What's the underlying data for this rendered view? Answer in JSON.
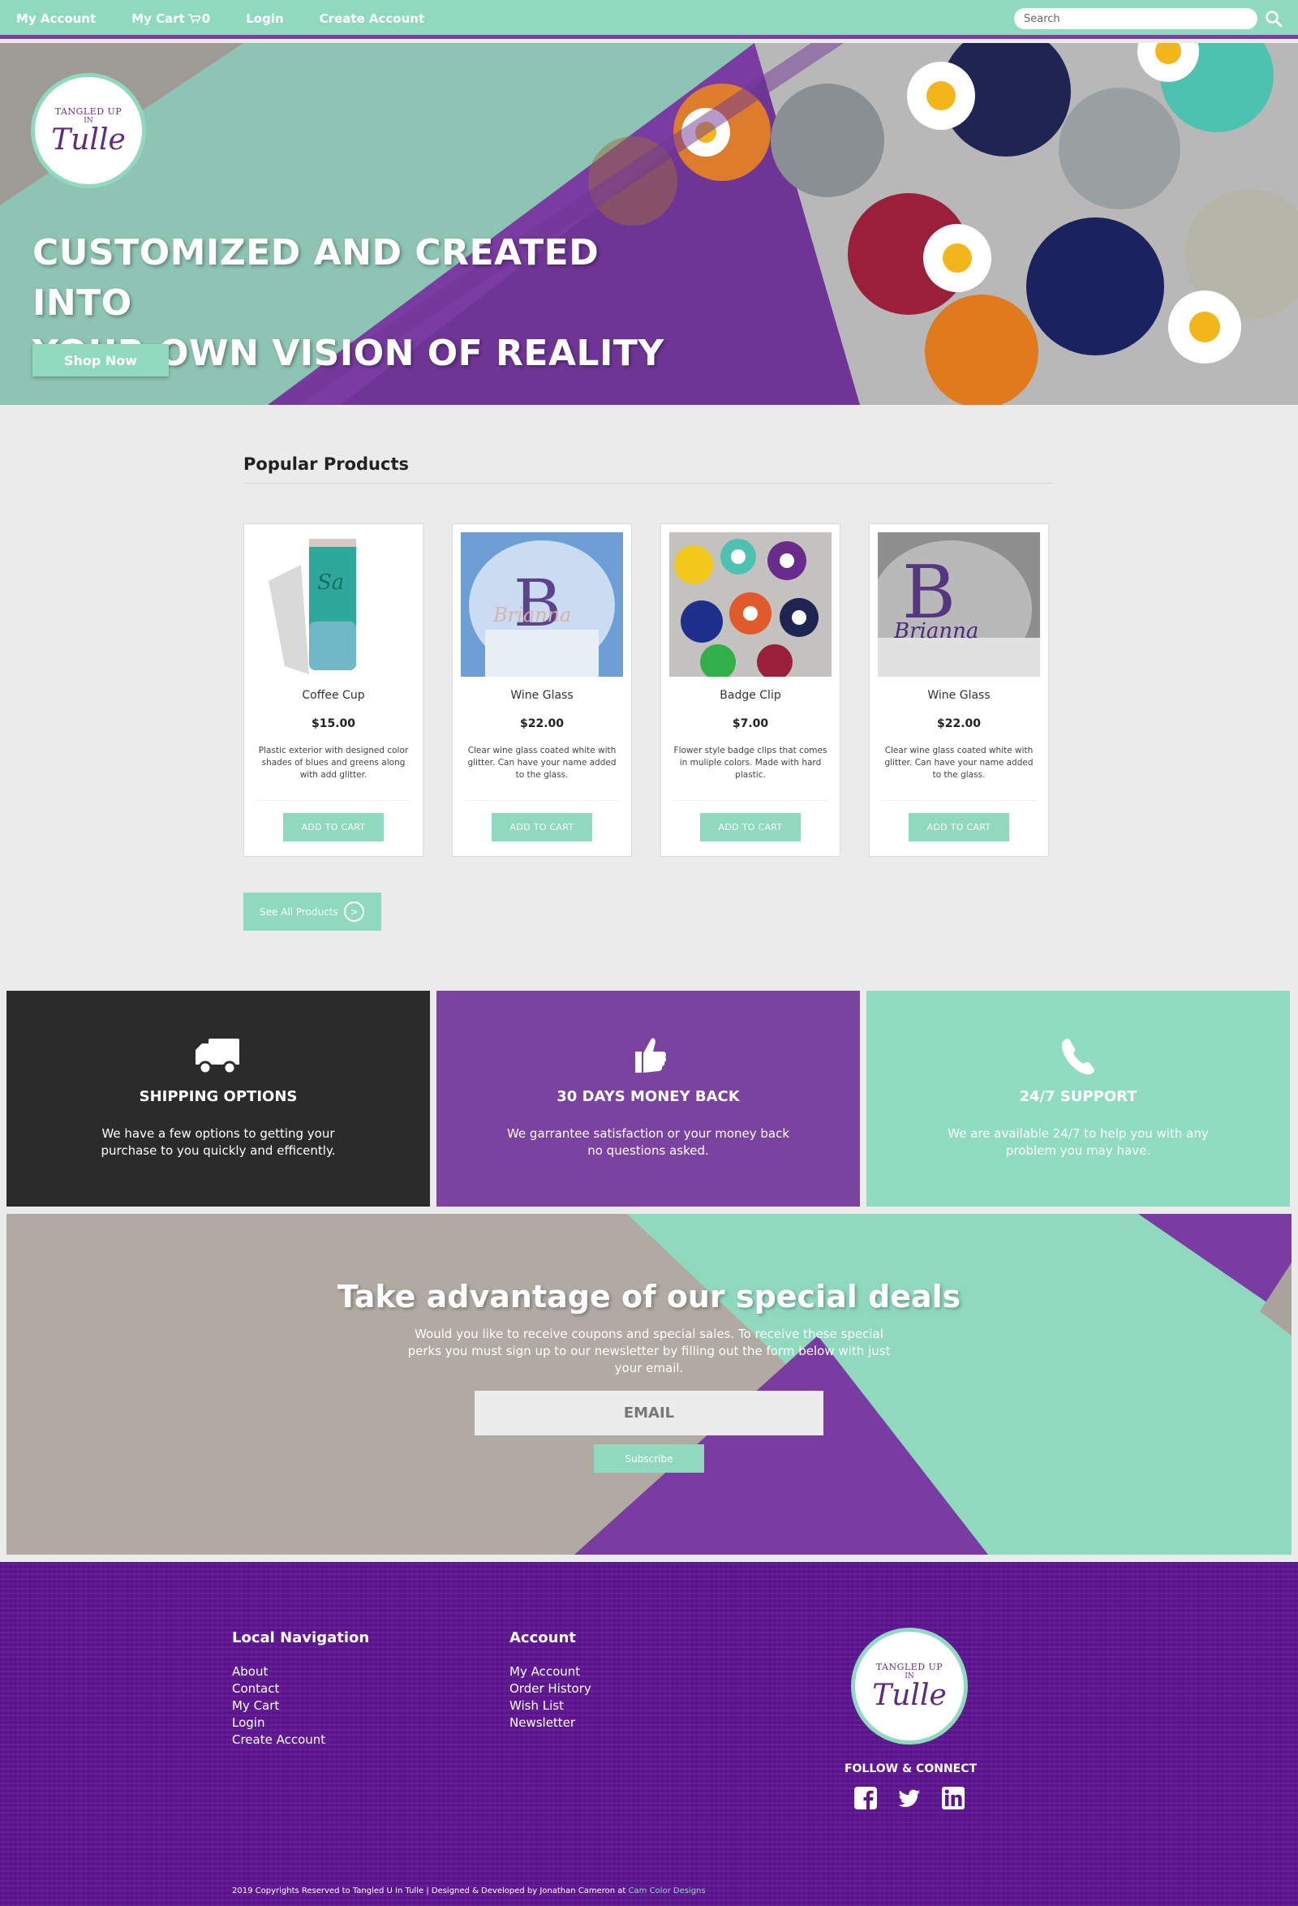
{
  "topnav": {
    "my_account": "My Account",
    "my_cart": "My Cart",
    "cart_count": "0",
    "login": "Login",
    "create_account": "Create Account",
    "search_placeholder": "Search"
  },
  "brand": {
    "logo_line1": "TANGLED UP",
    "logo_line2": "IN",
    "logo_line3": "Tulle"
  },
  "hero": {
    "title_line1": "CUSTOMIZED AND CREATED INTO",
    "title_line2": "YOUR OWN VISION OF REALITY",
    "cta": "Shop Now"
  },
  "popular": {
    "title": "Popular Products",
    "products": [
      {
        "name": "Coffee Cup",
        "price": "$15.00",
        "desc": "Plastic exterior with designed color shades of blues and greens along with add glitter.",
        "button": "ADD TO CART"
      },
      {
        "name": "Wine Glass",
        "price": "$22.00",
        "desc": "Clear wine glass coated white with glitter. Can have your name added to the glass.",
        "button": "ADD TO CART"
      },
      {
        "name": "Badge Clip",
        "price": "$7.00",
        "desc": "Flower style badge clips that comes in muliple colors. Made with hard plastic.",
        "button": "ADD TO CART"
      },
      {
        "name": "Wine Glass",
        "price": "$22.00",
        "desc": "Clear wine glass coated white with glitter. Can have your name added to the glass.",
        "button": "ADD TO CART"
      }
    ],
    "see_all": "See All Products",
    "see_all_arrow": ">"
  },
  "features": [
    {
      "title": "SHIPPING OPTIONS",
      "desc": "We have a few options to getting your purchase to you quickly and efficently.",
      "icon": "truck-icon",
      "color": "#2b2b2b"
    },
    {
      "title": "30 DAYS MONEY BACK",
      "desc": "We garrantee satisfaction or your money back no questions asked.",
      "icon": "thumbs-up-icon",
      "color": "#7b43a0"
    },
    {
      "title": "24/7 SUPPORT",
      "desc": "We are available 24/7 to help you with any problem you may have.",
      "icon": "phone-icon",
      "color": "#8fdcc1"
    }
  ],
  "deals": {
    "title": "Take advantage of our special deals",
    "desc": "Would you like to receive coupons and special sales. To receive these special perks you must sign up to our newsletter by filling out the form below with just your email.",
    "email_placeholder": "EMAIL",
    "subscribe": "Subscribe"
  },
  "footer": {
    "local_nav_title": "Local Navigation",
    "local_nav": [
      "About",
      "Contact",
      "My Cart",
      "Login",
      "Create Account"
    ],
    "account_title": "Account",
    "account_links": [
      "My Account",
      "Order History",
      "Wish List",
      "Newsletter"
    ],
    "follow": "FOLLOW & CONNECT",
    "social": [
      "facebook-icon",
      "twitter-icon",
      "linkedin-icon"
    ],
    "copyright": "2019 Copyrights Reserved to Tangled U In Tulle | Designed & Developed by Jonathan Cameron at",
    "copyright_link": "Cam Color Designs"
  },
  "colors": {
    "mint": "#8fd9bf",
    "purple": "#7b43a0",
    "dark": "#2b2b2b",
    "footer_purple": "#5e1591"
  }
}
